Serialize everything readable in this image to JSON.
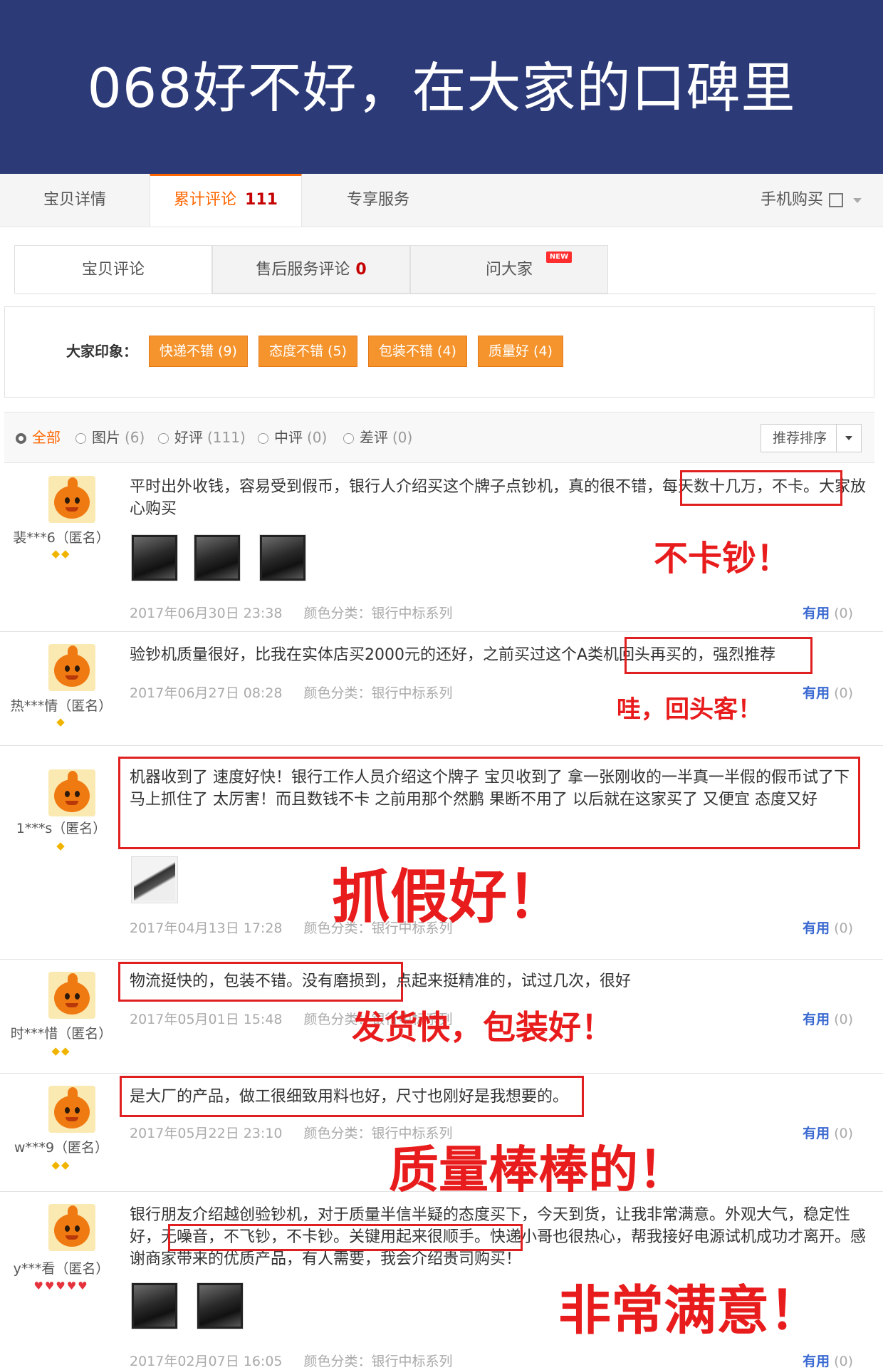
{
  "banner": {
    "title": "068好不好，在大家的口碑里"
  },
  "tabs": [
    {
      "label": "宝贝详情"
    },
    {
      "label": "累计评论",
      "count": "111"
    },
    {
      "label": "专享服务"
    }
  ],
  "mobile_buy": "手机购买",
  "subtabs": [
    {
      "label": "宝贝评论"
    },
    {
      "label": "售后服务评论",
      "count": "0"
    },
    {
      "label": "问大家",
      "badge": "NEW"
    }
  ],
  "impressions": {
    "label": "大家印象：",
    "tags": [
      "快递不错 (9)",
      "态度不错 (5)",
      "包装不错 (4)",
      "质量好 (4)"
    ]
  },
  "filters": [
    {
      "label": "全部",
      "count": ""
    },
    {
      "label": "图片",
      "count": "(6)"
    },
    {
      "label": "好评",
      "count": "(111)"
    },
    {
      "label": "中评",
      "count": "(0)"
    },
    {
      "label": "差评",
      "count": "(0)"
    }
  ],
  "sort": {
    "label": "推荐排序"
  },
  "useful_label": "有用",
  "reviews": [
    {
      "user": "裴***6（匿名）",
      "gems": "◆◆",
      "text": "平时出外收钱，容易受到假币，银行人介绍买这个牌子点钞机，真的很不错，每天数十几万，不卡。大家放心购买",
      "date": "2017年06月30日 23:38",
      "color": "颜色分类：银行中标系列",
      "useful_count": "(0)",
      "shout": "不卡钞！"
    },
    {
      "user": "热***情（匿名）",
      "gems": "◆",
      "text": "验钞机质量很好，比我在实体店买2000元的还好，之前买过这个A类机回头再买的，强烈推荐",
      "date": "2017年06月27日 08:28",
      "color": "颜色分类：银行中标系列",
      "useful_count": "(0)",
      "shout": "哇，回头客！"
    },
    {
      "user": "1***s（匿名）",
      "gems": "◆",
      "text": "机器收到了 速度好快！银行工作人员介绍这个牌子 宝贝收到了 拿一张刚收的一半真一半假的假币试了下 马上抓住了 太厉害！而且数钱不卡 之前用那个然鹏 果断不用了 以后就在这家买了 又便宜 态度又好",
      "date": "2017年04月13日 17:28",
      "color": "颜色分类：银行中标系列",
      "useful_count": "(0)",
      "shout": "抓假好！"
    },
    {
      "user": "时***惜（匿名）",
      "gems": "◆◆",
      "text": "物流挺快的，包装不错。没有磨损到，点起来挺精准的，试过几次，很好",
      "date": "2017年05月01日 15:48",
      "color": "颜色分类：银行中标系列",
      "useful_count": "(0)",
      "shout": "发货快，包装好！"
    },
    {
      "user": "w***9（匿名）",
      "gems": "◆◆",
      "text": "是大厂的产品，做工很细致用料也好，尺寸也刚好是我想要的。",
      "date": "2017年05月22日 23:10",
      "color": "颜色分类：银行中标系列",
      "useful_count": "(0)",
      "shout": "质量棒棒的！"
    },
    {
      "user": "y***看（匿名）",
      "gems": "♥♥♥♥♥",
      "text": "银行朋友介绍越创验钞机，对于质量半信半疑的态度买下，今天到货，让我非常满意。外观大气，稳定性好，无噪音，不飞钞，不卡钞。关键用起来很顺手。快递小哥也很热心，帮我接好电源试机成功才离开。感谢商家带来的优质产品，有人需要，我会介绍贵司购买！",
      "date": "2017年02月07日 16:05",
      "color": "颜色分类：银行中标系列",
      "useful_count": "(0)",
      "shout": "非常满意！"
    }
  ]
}
